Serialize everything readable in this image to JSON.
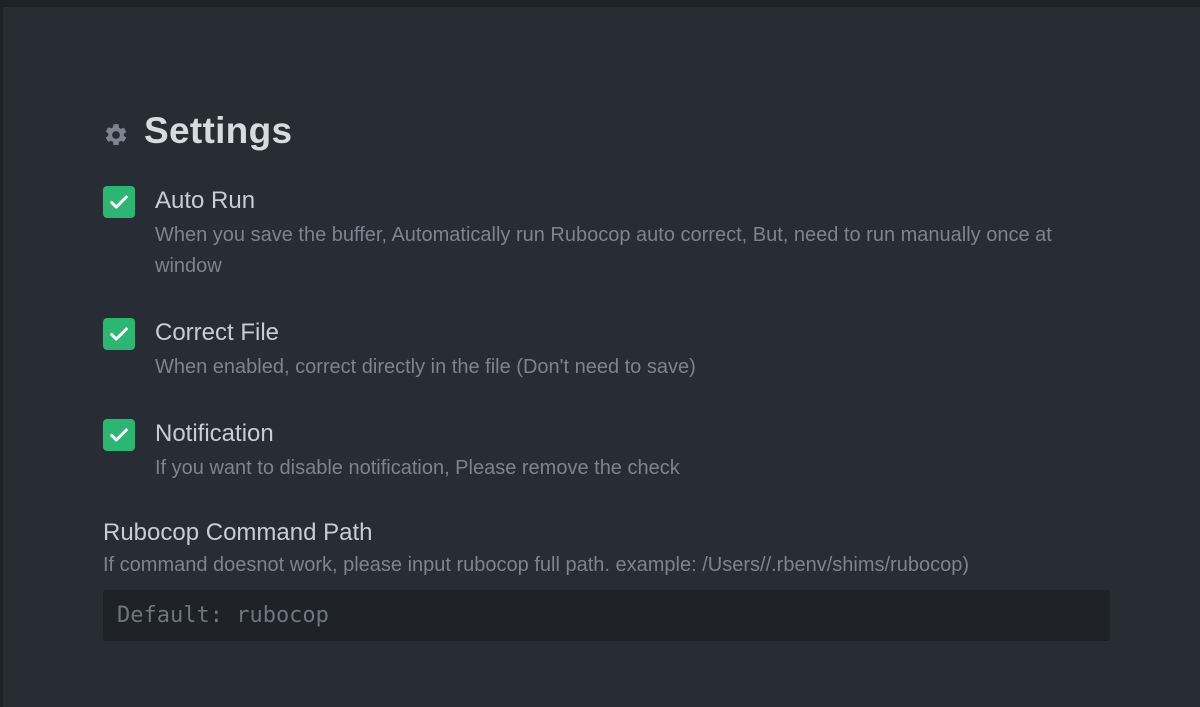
{
  "settings": {
    "title": "Settings",
    "icons": {
      "header": "gear-icon",
      "checkbox": "checkmark-icon"
    },
    "colors": {
      "background": "#282c34",
      "checkbox": "#2bb674",
      "input_background": "#1e2127"
    },
    "items": [
      {
        "label": "Auto Run",
        "description": "When you save the buffer, Automatically run Rubocop auto correct, But, need to run manually once at window",
        "checked": true
      },
      {
        "label": "Correct File",
        "description": "When enabled, correct directly in the file (Don't need to save)",
        "checked": true
      },
      {
        "label": "Notification",
        "description": "If you want to disable notification, Please remove the check",
        "checked": true
      }
    ],
    "command_path": {
      "label": "Rubocop Command Path",
      "description": "If command doesnot work, please input rubocop full path. example: /Users//.rbenv/shims/rubocop)",
      "value": "",
      "placeholder": "Default: rubocop"
    }
  }
}
